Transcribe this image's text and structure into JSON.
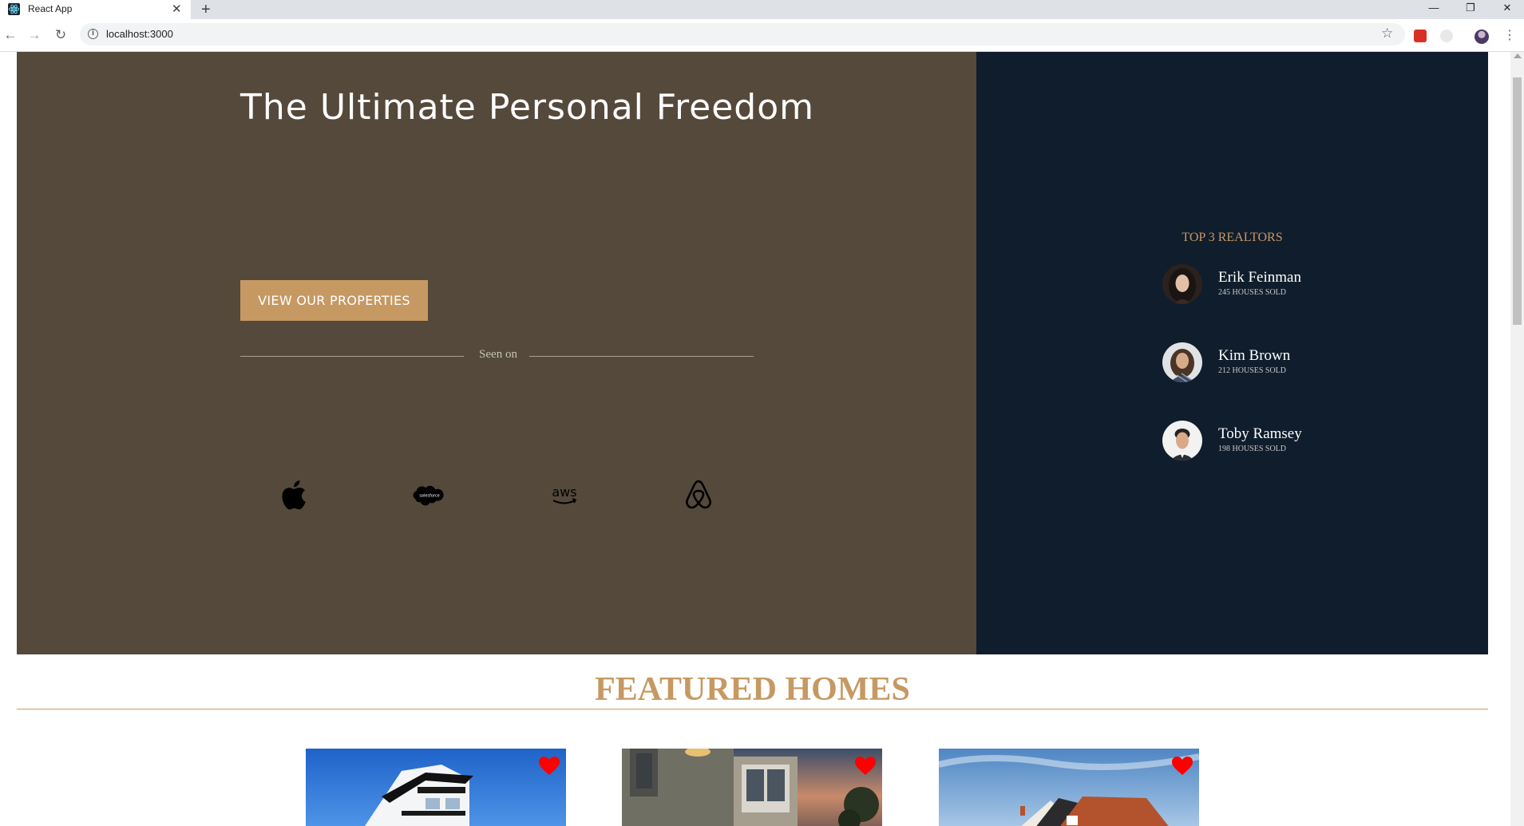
{
  "browser": {
    "tab_title": "React App",
    "tab_close": "✕",
    "new_tab": "+",
    "url": "localhost:3000",
    "window_controls": {
      "minimize": "—",
      "restore": "❐",
      "close": "✕"
    },
    "icons": [
      "react-favicon",
      "back-icon",
      "forward-icon",
      "reload-icon",
      "info-icon",
      "star-icon",
      "extension-icon",
      "profile-avatar",
      "menu-icon"
    ]
  },
  "hero": {
    "title": "The Ultimate Personal Freedom",
    "cta_label": "View our properties",
    "seen_on": "Seen on",
    "logos": [
      "apple-logo",
      "salesforce-logo",
      "aws-logo",
      "airbnb-logo"
    ],
    "background": "#54493b",
    "accent": "#c69963"
  },
  "sidebar": {
    "title": "Top 3 Realtors",
    "background": "#101d2c",
    "realtors": [
      {
        "name": "Erik Feinman",
        "sold": "245 Houses Sold"
      },
      {
        "name": "Kim Brown",
        "sold": "212 Houses Sold"
      },
      {
        "name": "Toby Ramsey",
        "sold": "198 Houses Sold"
      }
    ]
  },
  "featured": {
    "title": "Featured Homes",
    "cards": [
      "home-card-1",
      "home-card-2",
      "home-card-3"
    ],
    "heart_color": "#ff0000"
  }
}
